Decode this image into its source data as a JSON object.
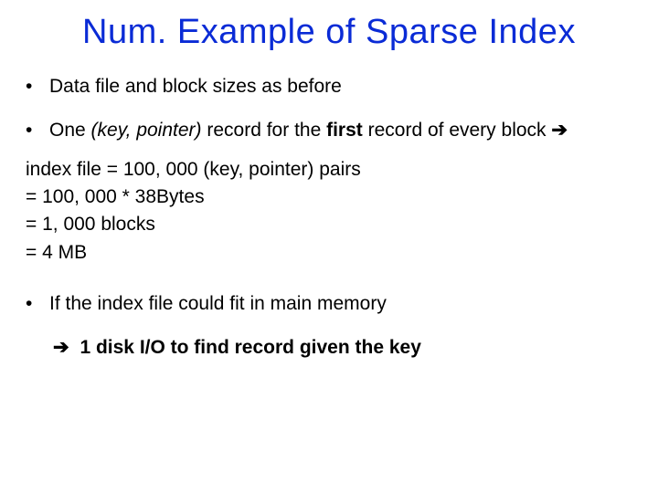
{
  "title": "Num. Example of Sparse Index",
  "b1": "Data file and block sizes as before",
  "b2_pre": "One ",
  "b2_italic": "(key, pointer)",
  "b2_mid": " record for the ",
  "b2_bold": "first",
  "b2_post": " record of every block ",
  "b2_arrow": "➔",
  "l_idx": "index file = 100, 000  (key, pointer) pairs",
  "l_bytes": "= 100, 000 * 38Bytes",
  "l_blocks": "= 1, 000 blocks",
  "l_mb": "= 4 MB",
  "b3": "If the index file could fit in main memory",
  "concl_arrow": "➔",
  "concl_text": " 1 disk I/O to find record given the key"
}
